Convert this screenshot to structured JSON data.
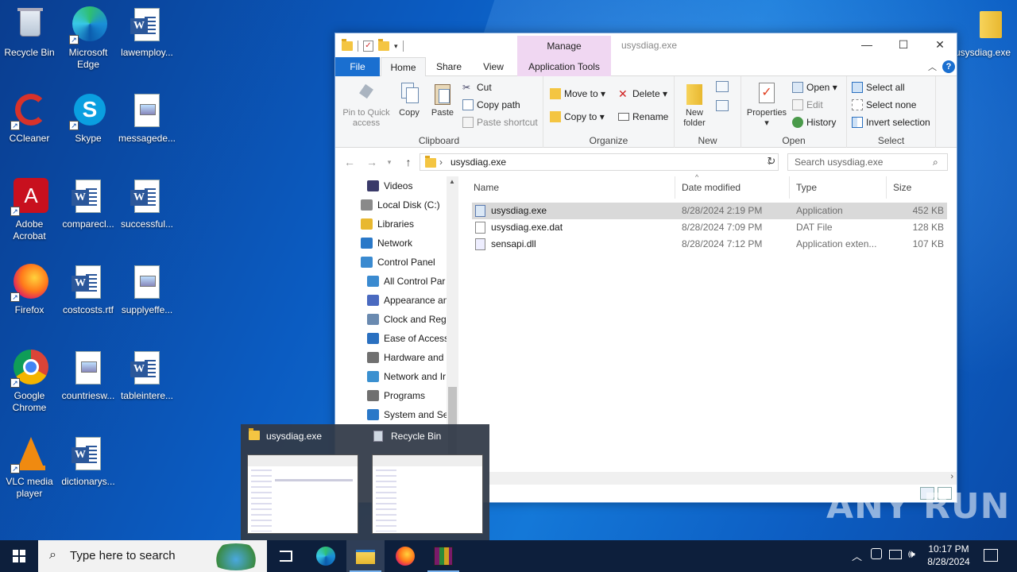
{
  "desktop": {
    "icons": [
      {
        "label": "Recycle Bin"
      },
      {
        "label": "Microsoft Edge"
      },
      {
        "label": "lawemploy..."
      },
      {
        "label": "CCleaner"
      },
      {
        "label": "Skype"
      },
      {
        "label": "messagede..."
      },
      {
        "label": "Adobe Acrobat"
      },
      {
        "label": "comparecl..."
      },
      {
        "label": "successful..."
      },
      {
        "label": "Firefox"
      },
      {
        "label": "costcosts.rtf"
      },
      {
        "label": "supplyeffe..."
      },
      {
        "label": "Google Chrome"
      },
      {
        "label": "countriesw..."
      },
      {
        "label": "tableintere..."
      },
      {
        "label": "VLC media player"
      },
      {
        "label": "dictionarys..."
      },
      {
        "label": "usysdiag.exe"
      }
    ]
  },
  "explorer": {
    "title": "usysdiag.exe",
    "contextual_tab": "Manage",
    "tabs": {
      "file": "File",
      "home": "Home",
      "share": "Share",
      "view": "View",
      "app_tools": "Application Tools"
    },
    "ribbon": {
      "clipboard": {
        "pin": "Pin to Quick access",
        "copy": "Copy",
        "paste": "Paste",
        "cut": "Cut",
        "copy_path": "Copy path",
        "paste_shortcut": "Paste shortcut",
        "label": "Clipboard"
      },
      "organize": {
        "move_to": "Move to",
        "copy_to": "Copy to",
        "delete": "Delete",
        "rename": "Rename",
        "label": "Organize"
      },
      "new": {
        "new_folder": "New folder",
        "label": "New"
      },
      "open": {
        "properties": "Properties",
        "open": "Open",
        "edit": "Edit",
        "history": "History",
        "label": "Open"
      },
      "select": {
        "select_all": "Select all",
        "select_none": "Select none",
        "invert": "Invert selection",
        "label": "Select"
      }
    },
    "address": {
      "path": "usysdiag.exe",
      "search_placeholder": "Search usysdiag.exe"
    },
    "nav_items": [
      {
        "label": "Videos",
        "color": "#3a3a6a"
      },
      {
        "label": "Local Disk (C:)",
        "color": "#8a8a8a"
      },
      {
        "label": "Libraries",
        "color": "#e8b830"
      },
      {
        "label": "Network",
        "color": "#2a78c8"
      },
      {
        "label": "Control Panel",
        "color": "#3a8ad0"
      },
      {
        "label": "All Control Par",
        "color": "#3a8ad0"
      },
      {
        "label": "Appearance an",
        "color": "#4a6ac0"
      },
      {
        "label": "Clock and Regi",
        "color": "#6a8ab0"
      },
      {
        "label": "Ease of Access",
        "color": "#2a70c0"
      },
      {
        "label": "Hardware and",
        "color": "#707070"
      },
      {
        "label": "Network and Ir",
        "color": "#3a90d0"
      },
      {
        "label": "Programs",
        "color": "#707070"
      },
      {
        "label": "System and Se",
        "color": "#2a78c8"
      }
    ],
    "columns": {
      "name": "Name",
      "date": "Date modified",
      "type": "Type",
      "size": "Size"
    },
    "files": [
      {
        "name": "usysdiag.exe",
        "date": "8/28/2024 2:19 PM",
        "type": "Application",
        "size": "452 KB"
      },
      {
        "name": "usysdiag.exe.dat",
        "date": "8/28/2024 7:09 PM",
        "type": "DAT File",
        "size": "128 KB"
      },
      {
        "name": "sensapi.dll",
        "date": "8/28/2024 7:12 PM",
        "type": "Application exten...",
        "size": "107 KB"
      }
    ]
  },
  "thumbnails": [
    {
      "title": "usysdiag.exe"
    },
    {
      "title": "Recycle Bin"
    }
  ],
  "taskbar": {
    "search_placeholder": "Type here to search",
    "time": "10:17 PM",
    "date": "8/28/2024"
  },
  "watermark": "ANY RUN"
}
